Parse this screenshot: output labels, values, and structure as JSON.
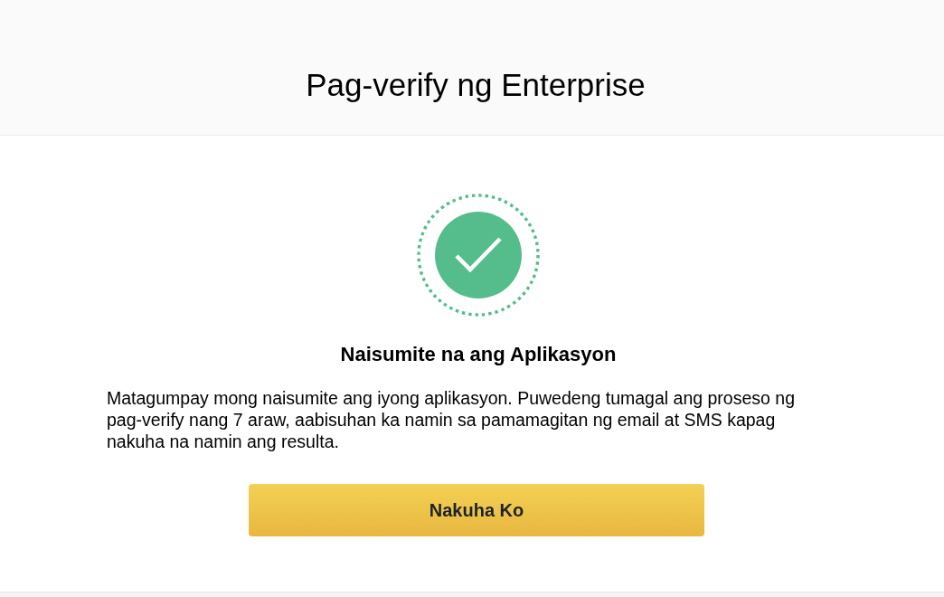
{
  "header": {
    "title": "Pag-verify ng Enterprise"
  },
  "status": {
    "kind": "success",
    "heading": "Naisumite na ang Aplikasyon",
    "message": "Matagumpay mong naisumite ang iyong aplikasyon. Puwedeng tumagal ang proseso ng pag-verify nang 7 araw, aabisuhan ka namin sa pamamagitan ng email at SMS kapag nakuha na namin ang resulta."
  },
  "buttons": [
    {
      "label": "Nakuha Ko",
      "kind": "primary"
    }
  ]
}
